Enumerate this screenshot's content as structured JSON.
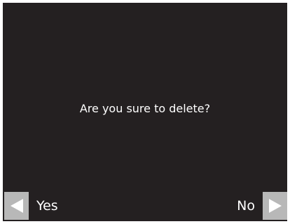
{
  "dialog": {
    "message": "Are you sure to delete?"
  },
  "actions": {
    "yes_label": "Yes",
    "no_label": "No"
  },
  "icons": {
    "yes": "arrow-left-icon",
    "no": "arrow-right-icon"
  },
  "colors": {
    "screen_background": "#242021",
    "text": "#ffffff",
    "arrow_box": "#b8b8b8",
    "arrow": "#ffffff",
    "frame": "#ffffff"
  }
}
